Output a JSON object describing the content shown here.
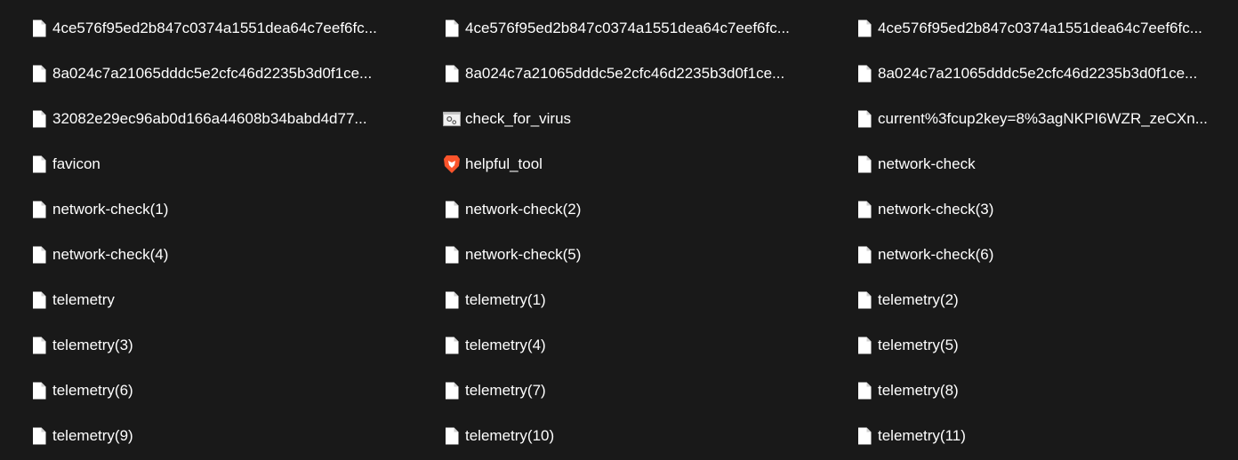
{
  "files": [
    {
      "name": "4ce576f95ed2b847c0374a1551dea64c7eef6fc...",
      "icon": "blank-file-icon"
    },
    {
      "name": "4ce576f95ed2b847c0374a1551dea64c7eef6fc...",
      "icon": "blank-file-icon"
    },
    {
      "name": "4ce576f95ed2b847c0374a1551dea64c7eef6fc...",
      "icon": "blank-file-icon"
    },
    {
      "name": "8a024c7a21065dddc5e2cfc46d2235b3d0f1ce...",
      "icon": "blank-file-icon"
    },
    {
      "name": "8a024c7a21065dddc5e2cfc46d2235b3d0f1ce...",
      "icon": "blank-file-icon"
    },
    {
      "name": "8a024c7a21065dddc5e2cfc46d2235b3d0f1ce...",
      "icon": "blank-file-icon"
    },
    {
      "name": "32082e29ec96ab0d166a44608b34babd4d77...",
      "icon": "blank-file-icon"
    },
    {
      "name": "check_for_virus",
      "icon": "executable-gear-icon"
    },
    {
      "name": "current%3fcup2key=8%3agNKPI6WZR_zeCXn...",
      "icon": "blank-file-icon"
    },
    {
      "name": "favicon",
      "icon": "blank-file-icon"
    },
    {
      "name": "helpful_tool",
      "icon": "brave-lion-icon"
    },
    {
      "name": "network-check",
      "icon": "blank-file-icon"
    },
    {
      "name": "network-check(1)",
      "icon": "blank-file-icon"
    },
    {
      "name": "network-check(2)",
      "icon": "blank-file-icon"
    },
    {
      "name": "network-check(3)",
      "icon": "blank-file-icon"
    },
    {
      "name": "network-check(4)",
      "icon": "blank-file-icon"
    },
    {
      "name": "network-check(5)",
      "icon": "blank-file-icon"
    },
    {
      "name": "network-check(6)",
      "icon": "blank-file-icon"
    },
    {
      "name": "telemetry",
      "icon": "blank-file-icon"
    },
    {
      "name": "telemetry(1)",
      "icon": "blank-file-icon"
    },
    {
      "name": "telemetry(2)",
      "icon": "blank-file-icon"
    },
    {
      "name": "telemetry(3)",
      "icon": "blank-file-icon"
    },
    {
      "name": "telemetry(4)",
      "icon": "blank-file-icon"
    },
    {
      "name": "telemetry(5)",
      "icon": "blank-file-icon"
    },
    {
      "name": "telemetry(6)",
      "icon": "blank-file-icon"
    },
    {
      "name": "telemetry(7)",
      "icon": "blank-file-icon"
    },
    {
      "name": "telemetry(8)",
      "icon": "blank-file-icon"
    },
    {
      "name": "telemetry(9)",
      "icon": "blank-file-icon"
    },
    {
      "name": "telemetry(10)",
      "icon": "blank-file-icon"
    },
    {
      "name": "telemetry(11)",
      "icon": "blank-file-icon"
    }
  ],
  "colors": {
    "background": "#191919",
    "text": "#ffffff",
    "file_icon_fill": "#ffffff",
    "brave_orange": "#fb542b"
  }
}
